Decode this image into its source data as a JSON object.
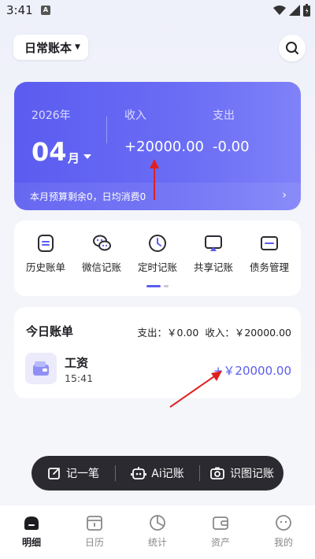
{
  "status": {
    "time": "3:41",
    "notif": "A"
  },
  "header": {
    "book_name": "日常账本"
  },
  "summary": {
    "year": "2026年",
    "month": "04",
    "month_unit": "月",
    "income_label": "收入",
    "income_value": "+20000.00",
    "expense_label": "支出",
    "expense_value": "-0.00",
    "budget_text": "本月预算剩余0，日均消费0"
  },
  "quick_menu": {
    "items": [
      {
        "label": "历史账单",
        "icon": "history-bill-icon"
      },
      {
        "label": "微信记账",
        "icon": "wechat-icon"
      },
      {
        "label": "定时记账",
        "icon": "clock-icon"
      },
      {
        "label": "共享记账",
        "icon": "share-icon"
      },
      {
        "label": "债务管理",
        "icon": "card-icon"
      }
    ]
  },
  "today": {
    "title": "今日账单",
    "expense_summary": "支出：￥0.00",
    "income_summary": "收入：￥20000.00",
    "entries": [
      {
        "name": "工资",
        "time": "15:41",
        "amount": "+￥20000.00",
        "icon": "wallet-icon"
      }
    ]
  },
  "actions": [
    {
      "label": "记一笔",
      "icon": "edit-icon"
    },
    {
      "label": "Ai记账",
      "icon": "robot-icon"
    },
    {
      "label": "识图记账",
      "icon": "camera-icon"
    }
  ],
  "nav": [
    {
      "label": "明细",
      "icon": "detail-icon",
      "active": true
    },
    {
      "label": "日历",
      "icon": "calendar-icon",
      "active": false
    },
    {
      "label": "统计",
      "icon": "chart-icon",
      "active": false
    },
    {
      "label": "资产",
      "icon": "wallet-icon",
      "active": false
    },
    {
      "label": "我的",
      "icon": "profile-icon",
      "active": false
    }
  ],
  "colors": {
    "accent": "#5b5cf0",
    "annotation": "#e02020",
    "action_bar": "#2a2a30"
  }
}
